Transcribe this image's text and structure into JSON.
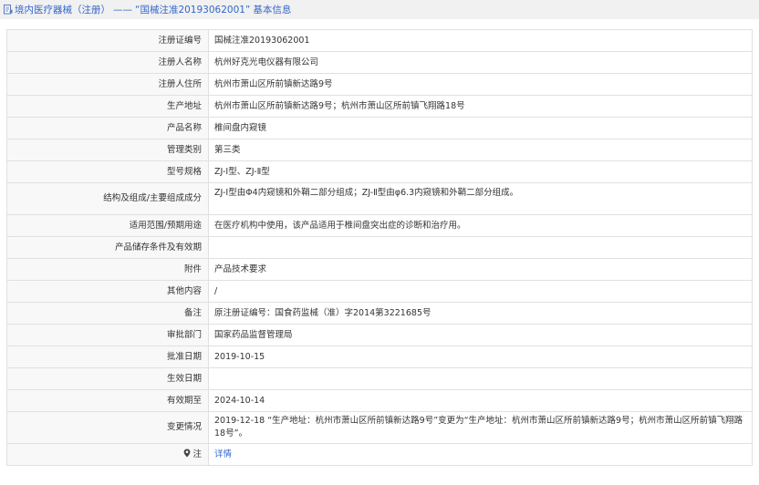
{
  "breadcrumb": {
    "section": "境内医疗器械（注册）",
    "separator": "——",
    "current": "“国械注准20193062001”",
    "suffix": "基本信息"
  },
  "rows": [
    {
      "label": "注册证编号",
      "value": "国械注准20193062001"
    },
    {
      "label": "注册人名称",
      "value": "杭州好克光电仪器有限公司"
    },
    {
      "label": "注册人住所",
      "value": "杭州市萧山区所前镇新达路9号"
    },
    {
      "label": "生产地址",
      "value": "杭州市萧山区所前镇新达路9号；杭州市萧山区所前镇飞翔路18号"
    },
    {
      "label": "产品名称",
      "value": "椎间盘内窥镜"
    },
    {
      "label": "管理类别",
      "value": "第三类"
    },
    {
      "label": "型号规格",
      "value": "ZJ-Ⅰ型、ZJ-Ⅱ型"
    },
    {
      "label": "结构及组成/主要组成成分",
      "value": "ZJ-Ⅰ型由Φ4内窥镜和外鞘二部分组成；ZJ-Ⅱ型由φ6.3内窥镜和外鞘二部分组成。"
    },
    {
      "label": "适用范围/预期用途",
      "value": "在医疗机构中使用，该产品适用于椎间盘突出症的诊断和治疗用。"
    },
    {
      "label": "产品储存条件及有效期",
      "value": ""
    },
    {
      "label": "附件",
      "value": "产品技术要求"
    },
    {
      "label": "其他内容",
      "value": "/"
    },
    {
      "label": "备注",
      "value": "原注册证编号：国食药监械（准）字2014第3221685号"
    },
    {
      "label": "审批部门",
      "value": "国家药品监督管理局"
    },
    {
      "label": "批准日期",
      "value": "2019-10-15"
    },
    {
      "label": "生效日期",
      "value": ""
    },
    {
      "label": "有效期至",
      "value": "2024-10-14"
    },
    {
      "label": "变更情况",
      "value": "2019-12-18 “生产地址：杭州市萧山区所前镇新达路9号”变更为“生产地址：杭州市萧山区所前镇新达路9号；杭州市萧山区所前镇飞翔路18号”。"
    }
  ],
  "note": {
    "label": "注",
    "link_text": "详情"
  },
  "colors": {
    "link": "#3366cc",
    "border": "#e0e0e0",
    "header_bg": "#f1f1f1",
    "label_bg": "#f8f8f8"
  },
  "icons": {
    "breadcrumb": "document-icon",
    "note": "location-pin-icon"
  }
}
